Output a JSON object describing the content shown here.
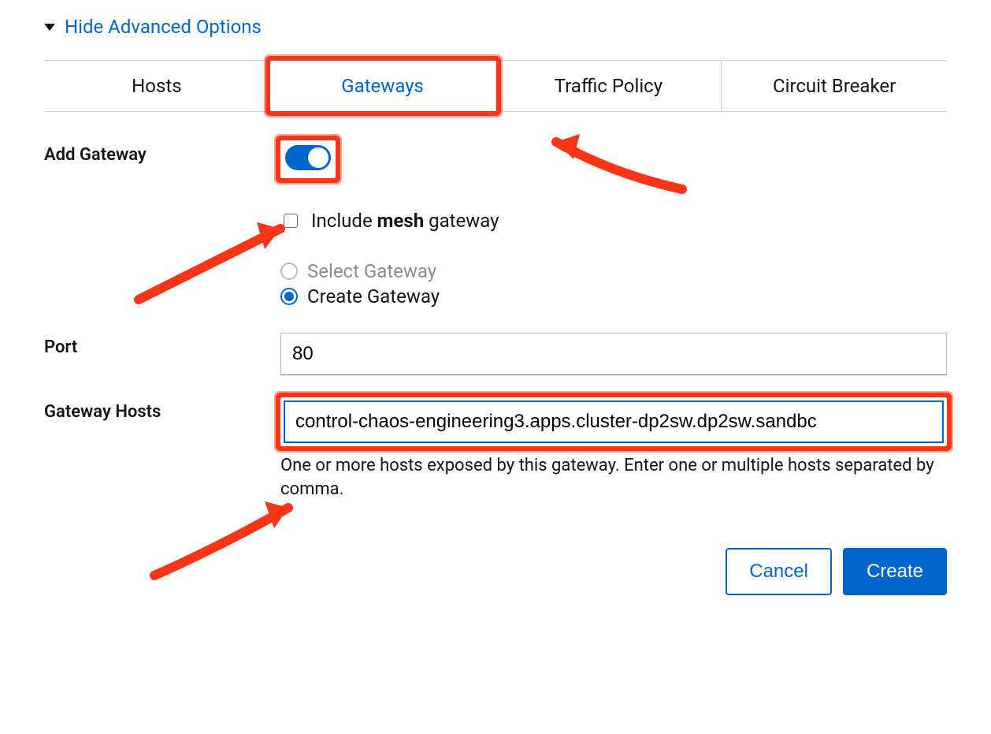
{
  "advanced_toggle": "Hide Advanced Options",
  "tabs": {
    "hosts": "Hosts",
    "gateways": "Gateways",
    "traffic_policy": "Traffic Policy",
    "circuit_breaker": "Circuit Breaker"
  },
  "gateway": {
    "add_label": "Add Gateway",
    "include_mesh_prefix": "Include ",
    "include_mesh_bold": "mesh",
    "include_mesh_suffix": " gateway",
    "radio_select": "Select Gateway",
    "radio_create": "Create Gateway",
    "port_label": "Port",
    "port_value": "80",
    "hosts_label": "Gateway Hosts",
    "hosts_value": "control-chaos-engineering3.apps.cluster-dp2sw.dp2sw.sandbc",
    "hosts_help": "One or more hosts exposed by this gateway. Enter one or multiple hosts separated by comma."
  },
  "buttons": {
    "cancel": "Cancel",
    "create": "Create"
  }
}
